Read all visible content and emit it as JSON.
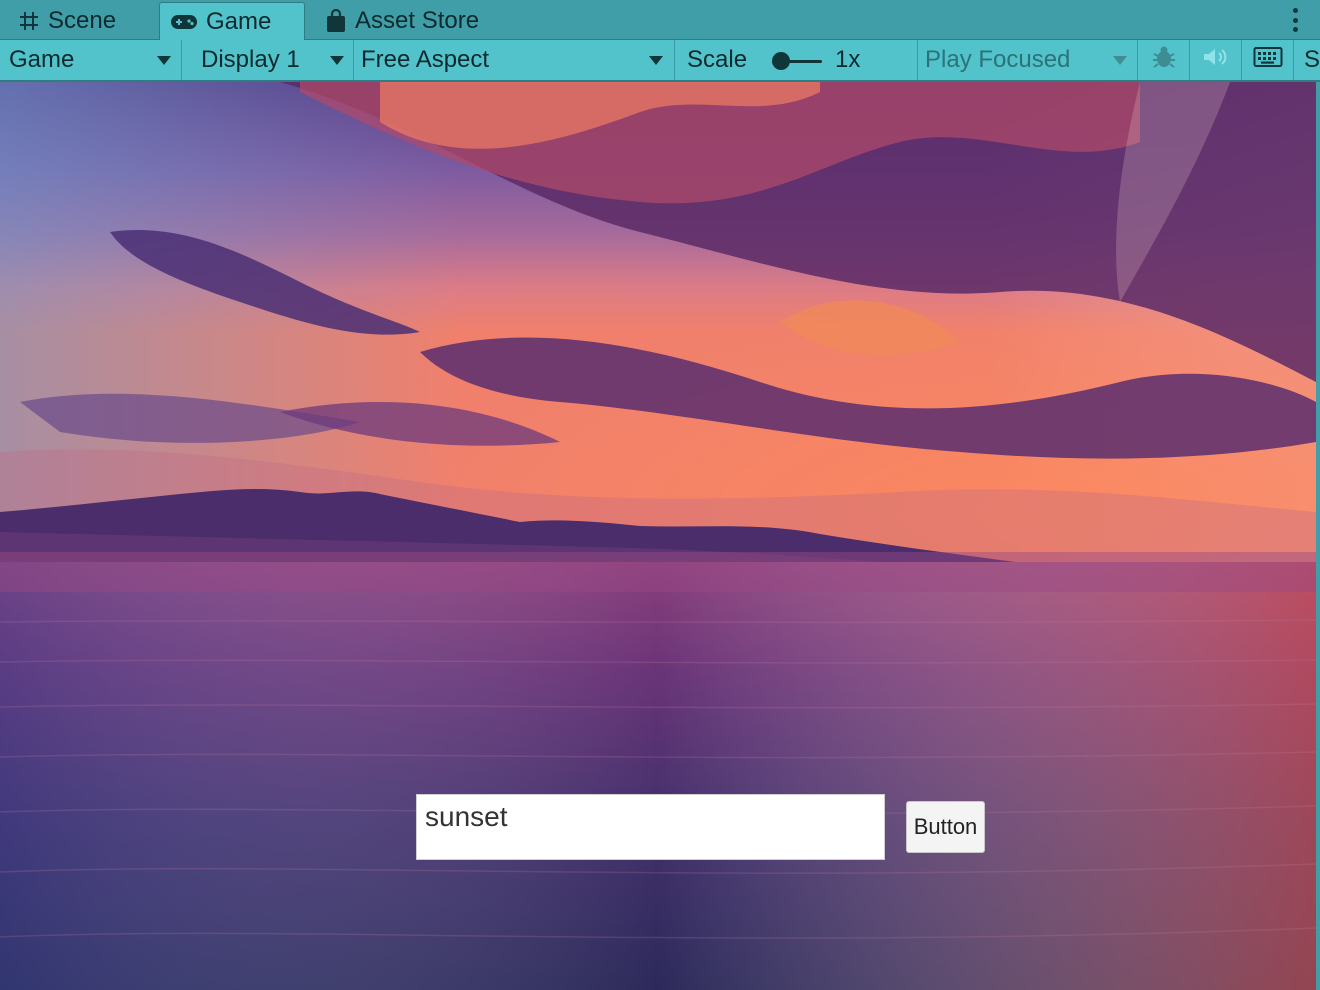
{
  "tabs": [
    {
      "label": "Scene",
      "icon": "grid-icon",
      "active": false
    },
    {
      "label": "Game",
      "icon": "gamepad-icon",
      "active": true
    },
    {
      "label": "Asset Store",
      "icon": "shopping-bag-icon",
      "active": false
    }
  ],
  "toolbar": {
    "display_mode": "Game",
    "display": "Display 1",
    "aspect": "Free Aspect",
    "scale_label": "Scale",
    "scale_value": "1x",
    "scale_level": 0,
    "play_mode": "Play Focused",
    "stats_label_partial": "S",
    "icons": [
      "bug-icon",
      "speaker-icon",
      "keyboard-icon"
    ]
  },
  "game_ui": {
    "input_value": "sunset",
    "button_label": "Button"
  },
  "colors": {
    "tabbar_bg": "#3f9ea7",
    "toolbar_bg": "#52c3cb",
    "active_tab_bg": "#52c3cb",
    "text": "#0e2a2e"
  }
}
